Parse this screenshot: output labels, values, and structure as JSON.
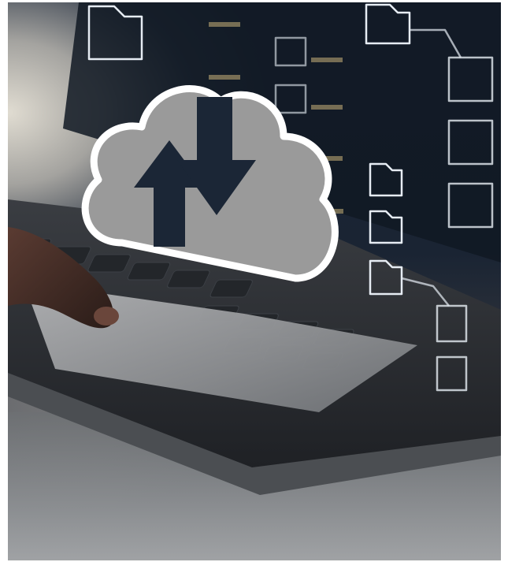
{
  "image": {
    "subject": "cloud-upload-download",
    "colors": {
      "navy": "#1b2636",
      "cloud_fill": "#9a9a9a",
      "cloud_outline": "#ffffff",
      "laptop_dark": "#2a2d31",
      "trackpad": "#8f9194"
    },
    "icons": [
      "cloud-icon",
      "upload-arrow-icon",
      "download-arrow-icon",
      "folder-icon"
    ]
  }
}
